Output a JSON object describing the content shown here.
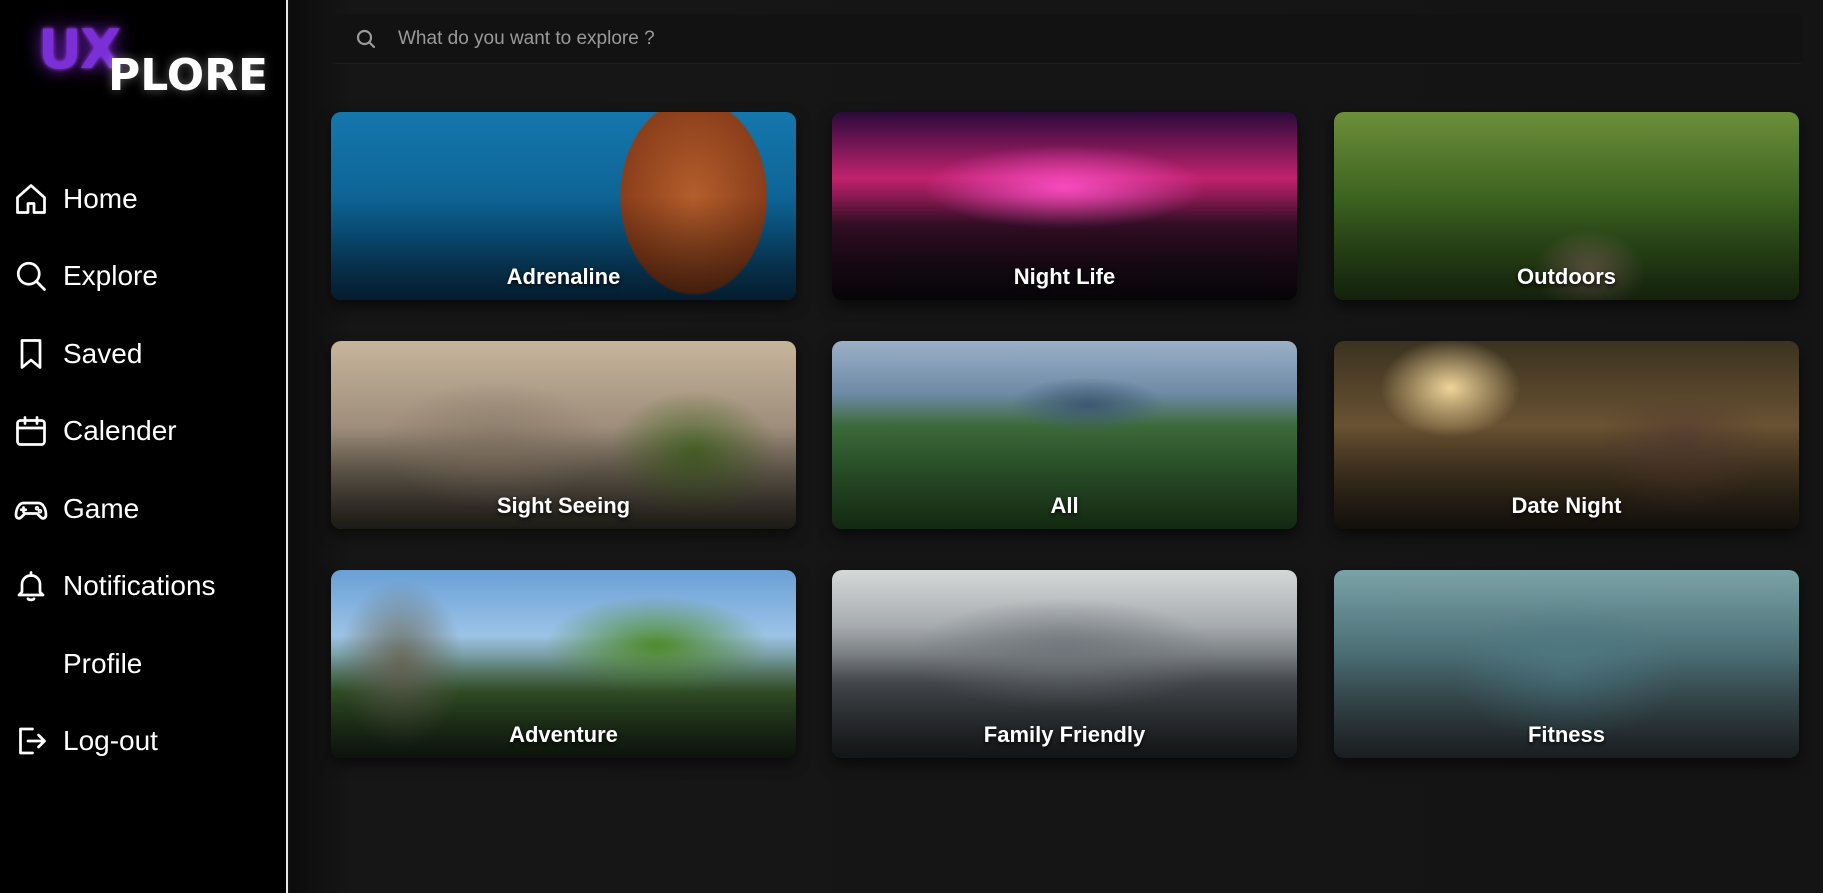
{
  "brand": {
    "logo_ux": "UX",
    "logo_plore": "PLORE"
  },
  "sidebar": {
    "items": [
      {
        "label": "Home",
        "icon": "home-icon"
      },
      {
        "label": "Explore",
        "icon": "search-icon"
      },
      {
        "label": "Saved",
        "icon": "bookmark-icon"
      },
      {
        "label": "Calender",
        "icon": "calendar-icon"
      },
      {
        "label": "Game",
        "icon": "gamepad-icon"
      },
      {
        "label": "Notifications",
        "icon": "bell-icon"
      },
      {
        "label": "Profile",
        "icon": ""
      },
      {
        "label": "Log-out",
        "icon": "logout-icon"
      }
    ]
  },
  "search": {
    "placeholder": "What do you want to explore ?"
  },
  "categories": [
    {
      "title": "Adrenaline"
    },
    {
      "title": "Night Life"
    },
    {
      "title": "Outdoors"
    },
    {
      "title": "Sight Seeing"
    },
    {
      "title": "All"
    },
    {
      "title": "Date Night"
    },
    {
      "title": "Adventure"
    },
    {
      "title": "Family Friendly"
    },
    {
      "title": "Fitness"
    }
  ],
  "colors": {
    "sidebar_bg": "#000000",
    "main_bg": "#141414",
    "accent_purple": "#7b2fd6",
    "text": "#ffffff",
    "placeholder": "#9a9a9a"
  }
}
